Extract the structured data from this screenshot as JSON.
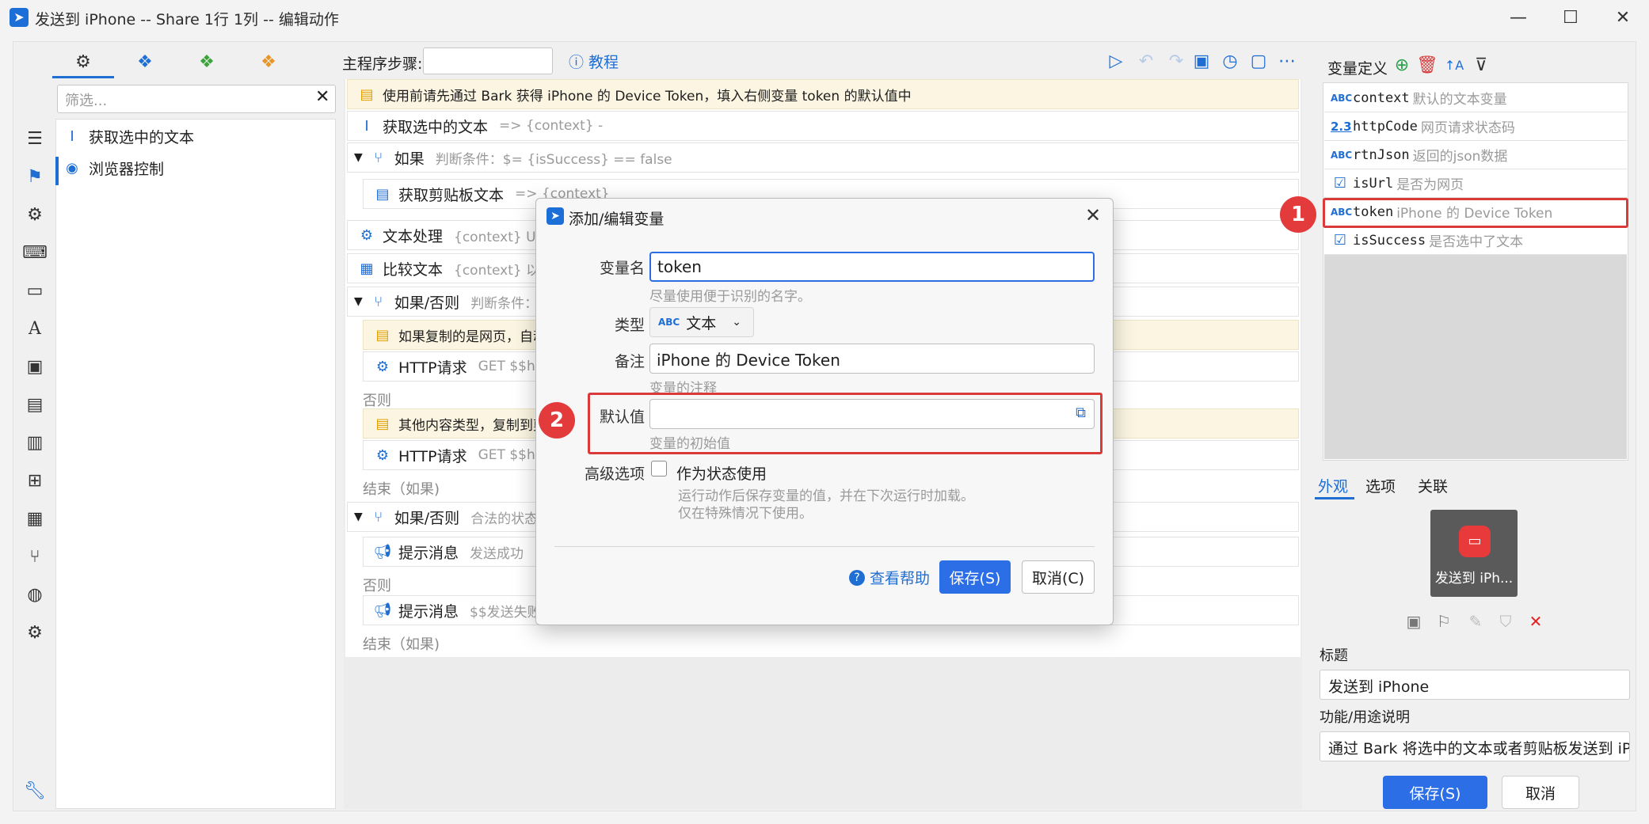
{
  "window": {
    "title": "发送到 iPhone -- Share 1行 1列 -- 编辑动作",
    "min_icon": "minimize-icon",
    "max_icon": "maximize-icon",
    "close_icon": "close-icon"
  },
  "left_panel": {
    "tabs": [
      "gears-icon",
      "cubes-blue-icon",
      "cubes-green-icon",
      "cubes-orange-icon"
    ],
    "filter_placeholder": "筛选...",
    "items": [
      {
        "label": "获取选中的文本",
        "icon": "text-cursor-icon"
      },
      {
        "label": "浏览器控制",
        "icon": "chrome-icon"
      }
    ]
  },
  "rail_icons": [
    "menu-icon",
    "bookmark-icon",
    "gear-icon",
    "keyboard-icon",
    "window-icon",
    "font-icon",
    "image-icon",
    "clipboard-icon",
    "document-icon",
    "windows-icon",
    "calculator-icon",
    "branch-icon",
    "globe-icon",
    "gears-icon",
    "wrench-icon"
  ],
  "toolbar": {
    "steps_label": "主程序步骤:",
    "tutorial": "教程",
    "icons": [
      "run-icon",
      "undo-icon",
      "redo-icon",
      "save-icon",
      "history-icon",
      "note-icon",
      "more-icon"
    ]
  },
  "steps": [
    {
      "title": "使用前请先通过 Bark 获得 iPhone 的 Device Token，填入右侧变量 token 的默认值中",
      "desc": ""
    },
    {
      "title": "获取选中的文本",
      "desc": "=> {context} -"
    },
    {
      "title": "如果",
      "desc": "判断条件：$= {isSuccess} == false"
    },
    {
      "title": "获取剪贴板文本",
      "desc": "=> {context}"
    },
    {
      "title": "文本处理",
      "desc": "{context} URL编"
    },
    {
      "title": "比较文本",
      "desc": "{context} 以指定"
    },
    {
      "title": "如果/否则",
      "desc": "判断条件：{"
    },
    {
      "title": "如果复制的是网页，自动",
      "desc": ""
    },
    {
      "title": "HTTP请求",
      "desc": "GET $$http"
    },
    {
      "title": "否则",
      "desc": ""
    },
    {
      "title": "其他内容类型，复制到剪",
      "desc": ""
    },
    {
      "title": "HTTP请求",
      "desc": "GET $$http"
    },
    {
      "title": "结束（如果)",
      "desc": ""
    },
    {
      "title": "如果/否则",
      "desc": "合法的状态码"
    },
    {
      "title": "提示消息",
      "desc": "发送成功"
    },
    {
      "title": "否则",
      "desc": ""
    },
    {
      "title": "提示消息",
      "desc": "$$发送失败:"
    },
    {
      "title": "结束（如果)",
      "desc": ""
    }
  ],
  "variables": {
    "title": "变量定义",
    "items": [
      {
        "name": "context",
        "desc": "默认的文本变量",
        "type": "ABC"
      },
      {
        "name": "httpCode",
        "desc": "网页请求状态码",
        "type": "2.3"
      },
      {
        "name": "rtnJson",
        "desc": "返回的json数据",
        "type": "ABC"
      },
      {
        "name": "isUrl",
        "desc": "是否为网页",
        "type": "☑"
      },
      {
        "name": "token",
        "desc": "iPhone 的 Device Token",
        "type": "ABC"
      },
      {
        "name": "isSuccess",
        "desc": "是否选中了文本",
        "type": "☑"
      }
    ]
  },
  "right_tabs": [
    "外观",
    "选项",
    "关联"
  ],
  "appearance": {
    "preview_label": "发送到 iPh...",
    "title_label": "标题",
    "title_value": "发送到 iPhone",
    "func_label": "功能/用途说明",
    "func_value": "通过 Bark 将选中的文本或者剪贴板发送到 iPhone",
    "save": "保存(S)",
    "cancel": "取消"
  },
  "dialog": {
    "title": "添加/编辑变量",
    "name_label": "变量名",
    "name_value": "token",
    "name_hint": "尽量使用便于识别的名字。",
    "type_label": "类型",
    "type_value": "文本",
    "type_badge": "ABC",
    "note_label": "备注",
    "note_value": "iPhone 的 Device Token",
    "note_hint": "变量的注释",
    "default_label": "默认值",
    "default_value": "",
    "default_hint": "变量的初始值",
    "adv_label": "高级选项",
    "state_label": "作为状态使用",
    "state_hint1": "运行动作后保存变量的值，并在下次运行时加载。",
    "state_hint2": "仅在特殊情况下使用。",
    "help": "查看帮助",
    "save": "保存(S)",
    "cancel": "取消(C)"
  },
  "annotations": {
    "badge1": "1",
    "badge2": "2"
  },
  "colors": {
    "accent": "#2b6ee6",
    "highlight": "#d93b3b"
  }
}
